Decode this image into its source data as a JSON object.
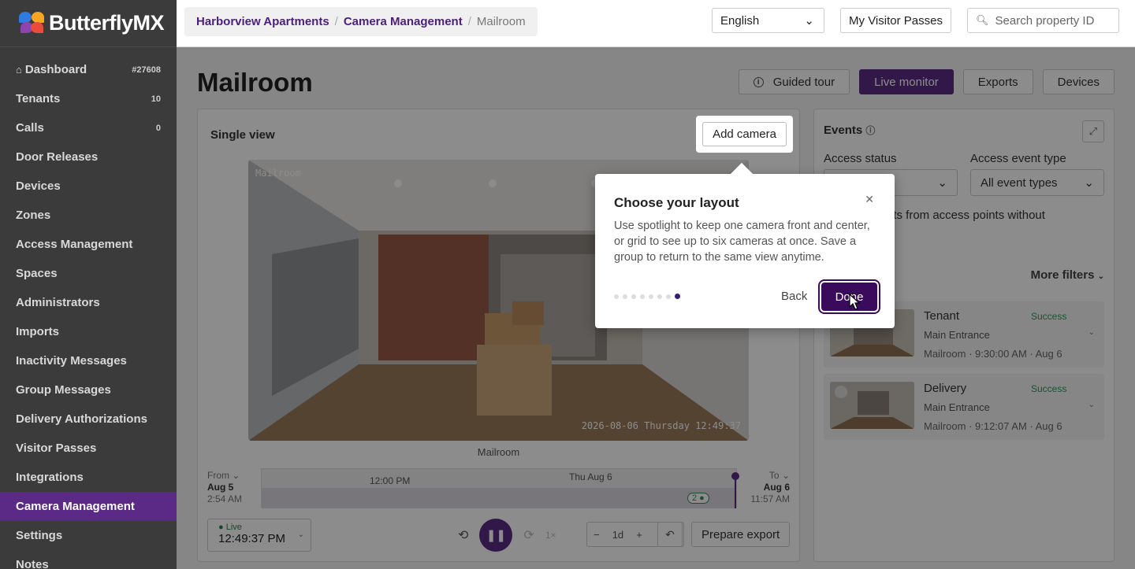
{
  "brand": {
    "name": "ButterflyMX"
  },
  "sidebar": {
    "items": [
      {
        "label": "Dashboard",
        "count": "#27608",
        "icon": "home-icon"
      },
      {
        "label": "Tenants",
        "count": "10"
      },
      {
        "label": "Calls",
        "count": "0"
      },
      {
        "label": "Door Releases",
        "count": ""
      },
      {
        "label": "Devices",
        "count": ""
      },
      {
        "label": "Zones",
        "count": ""
      },
      {
        "label": "Access Management",
        "count": ""
      },
      {
        "label": "Spaces",
        "count": ""
      },
      {
        "label": "Administrators",
        "count": ""
      },
      {
        "label": "Imports",
        "count": ""
      },
      {
        "label": "Inactivity Messages",
        "count": ""
      },
      {
        "label": "Group Messages",
        "count": ""
      },
      {
        "label": "Delivery Authorizations",
        "count": ""
      },
      {
        "label": "Visitor Passes",
        "count": ""
      },
      {
        "label": "Integrations",
        "count": ""
      },
      {
        "label": "Camera Management",
        "count": "",
        "active": true
      },
      {
        "label": "Settings",
        "count": ""
      },
      {
        "label": "Notes",
        "count": ""
      }
    ]
  },
  "header": {
    "breadcrumb": [
      "Harborview Apartments",
      "Camera Management",
      "Mailroom"
    ],
    "language": "English",
    "visitor_passes": "My Visitor Passes",
    "search_placeholder": "Search property ID"
  },
  "page": {
    "title": "Mailroom",
    "actions": [
      "Guided tour",
      "Live monitor",
      "Exports",
      "Devices"
    ]
  },
  "viewer": {
    "title": "Single view",
    "add_camera": "Add camera",
    "cam_label": "Mailroom",
    "timestamp": "2026-08-06 Thursday 12:49:37",
    "caption": "Mailroom",
    "timeline": {
      "from_label": "From",
      "from_date": "Aug 5",
      "from_time": "2:54 AM",
      "to_label": "To",
      "to_date": "Aug 6",
      "to_time": "11:57 AM",
      "tick_noon": "12:00 PM",
      "tick_day": "Thu Aug 6",
      "badge": "2 ●"
    },
    "live_label": "● Live",
    "live_time": "12:49:37 PM",
    "speed": "1×",
    "zoom_value": "1d",
    "prepare_export": "Prepare export"
  },
  "events": {
    "title": "Events",
    "access_status_label": "Access status",
    "event_type_label": "Access event type",
    "event_type_value": "All event types",
    "checkbox_text": "nts from access points without",
    "more_filters": "More filters",
    "items": [
      {
        "name": "Tenant",
        "status": "Success",
        "location": "Main Entrance",
        "meta": "Mailroom · 9:30:00 AM · Aug 6"
      },
      {
        "name": "Delivery",
        "status": "Success",
        "location": "Main Entrance",
        "meta": "Mailroom · 9:12:07 AM · Aug 6"
      }
    ]
  },
  "popover": {
    "title": "Choose your layout",
    "body": "Use spotlight to keep one camera front and center, or grid to see up to six cameras at once. Save a group to return to the same view anytime.",
    "back": "Back",
    "done": "Done",
    "steps_total": 8,
    "step_current": 8
  },
  "colors": {
    "brand": "#5b2a86",
    "sidebar": "#3b3b3b",
    "success": "#2e9a5a"
  }
}
